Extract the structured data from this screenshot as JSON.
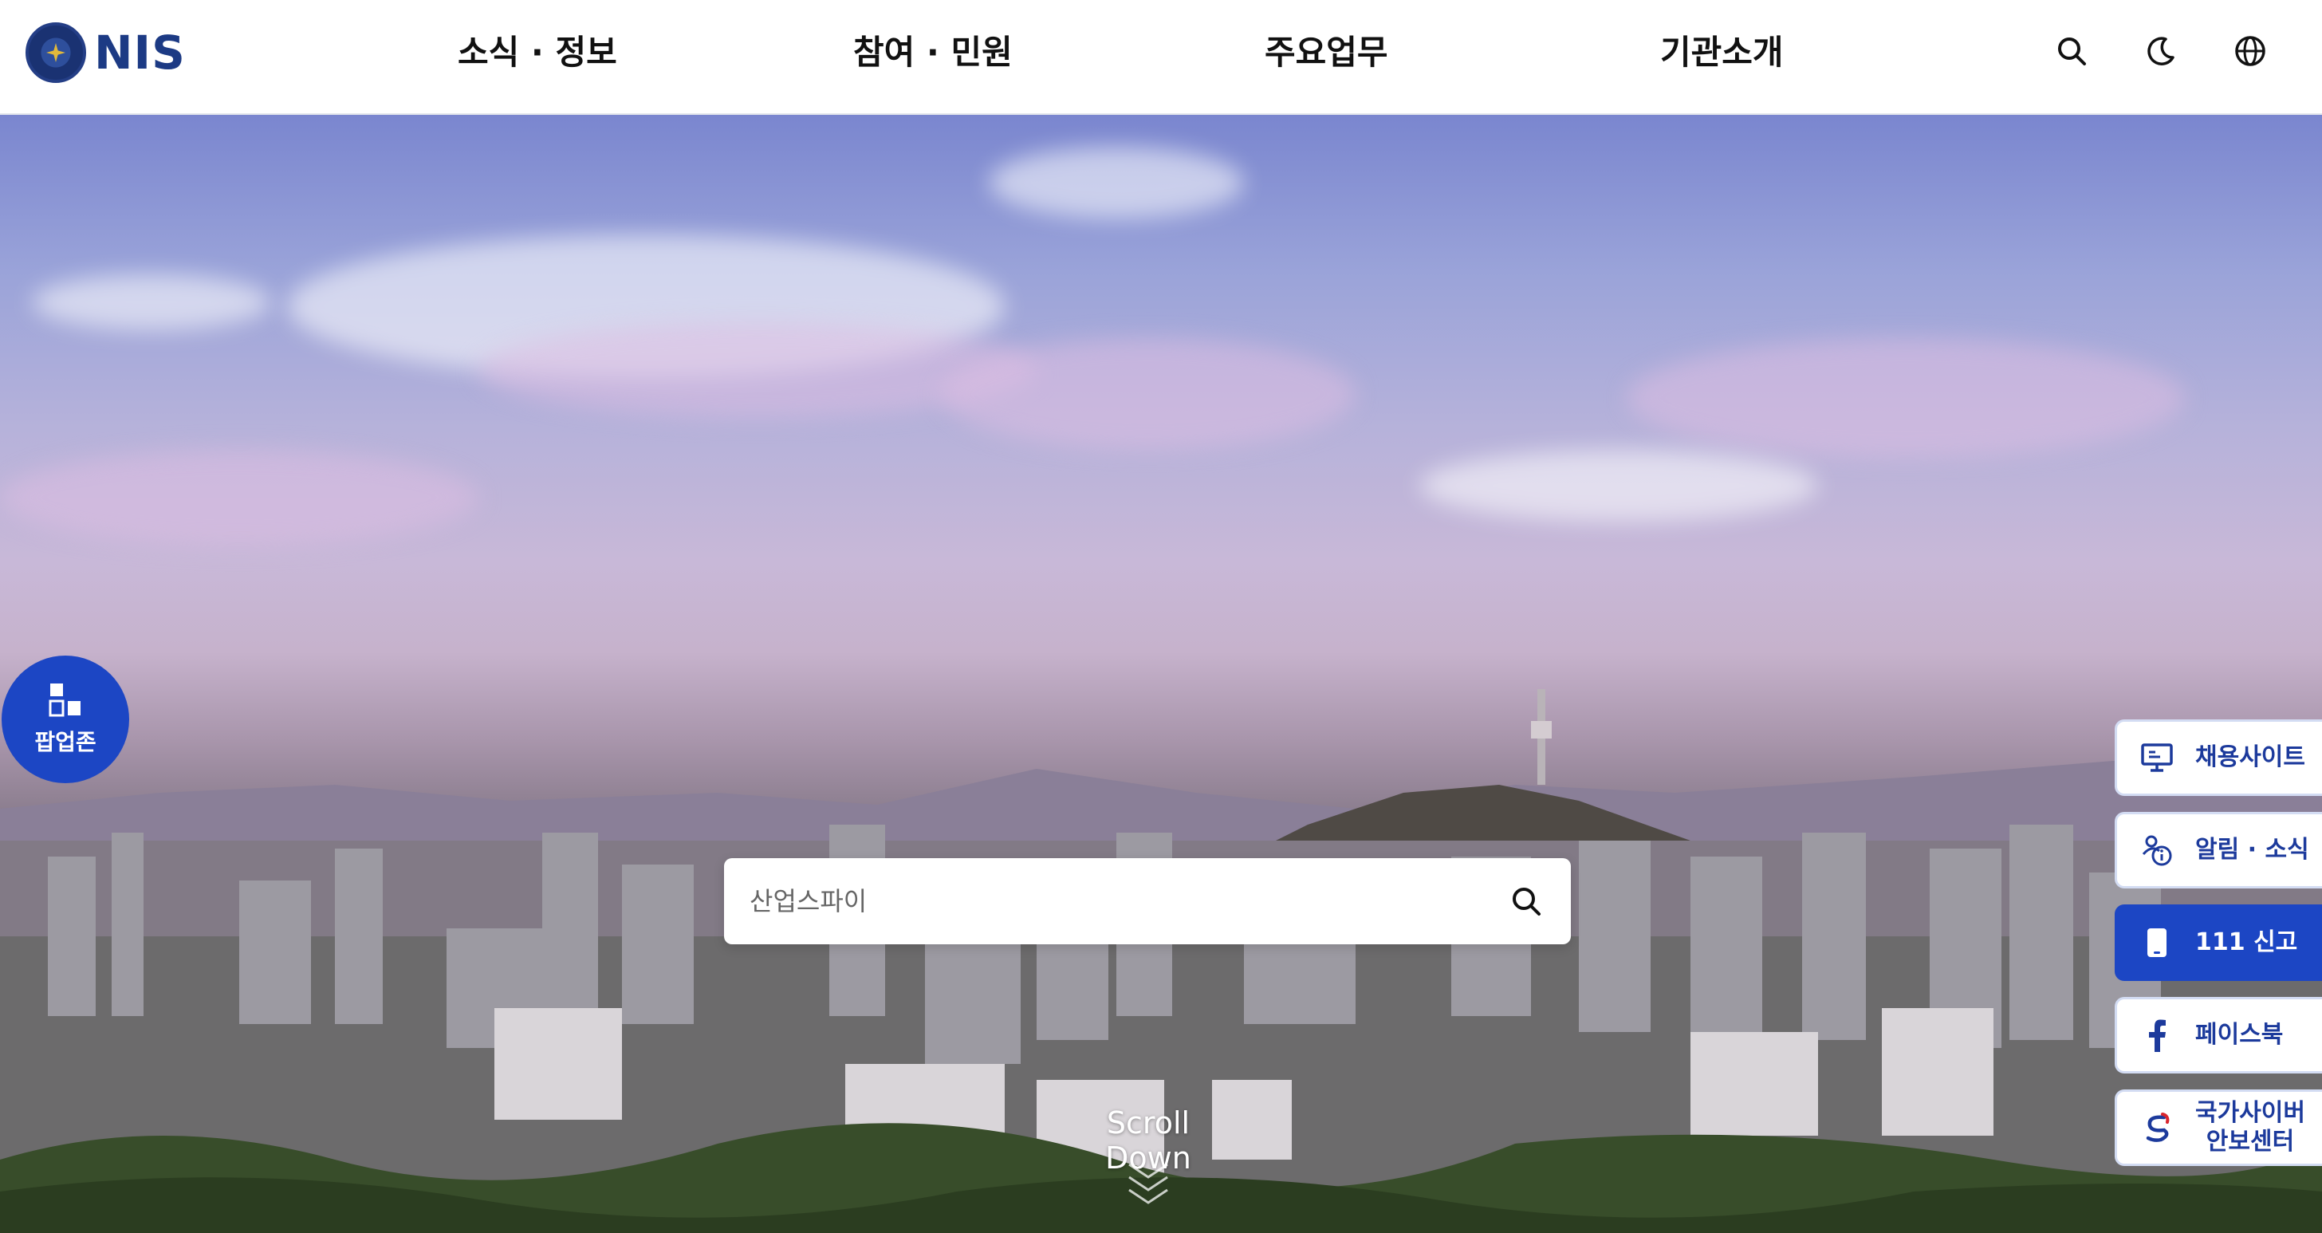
{
  "header": {
    "logo_text": "NIS",
    "nav": [
      "소식 · 정보",
      "참여 · 민원",
      "주요업무",
      "기관소개"
    ]
  },
  "hero": {
    "search_placeholder": "산업스파이",
    "scroll_label": "Scroll Down"
  },
  "popup_zone": {
    "label": "팝업존"
  },
  "quick_menu": [
    {
      "label": "채용사이트",
      "icon": "monitor-icon"
    },
    {
      "label": "알림 · 소식",
      "icon": "info-people-icon"
    },
    {
      "label": "111 신고",
      "icon": "phone-icon"
    },
    {
      "label": "페이스북",
      "icon": "facebook-icon"
    },
    {
      "label_line1": "국가사이버",
      "label_line2": "안보센터",
      "icon": "cyber-logo-icon"
    }
  ],
  "colors": {
    "brand": "#1c46c4",
    "logo": "#1c3a84"
  }
}
